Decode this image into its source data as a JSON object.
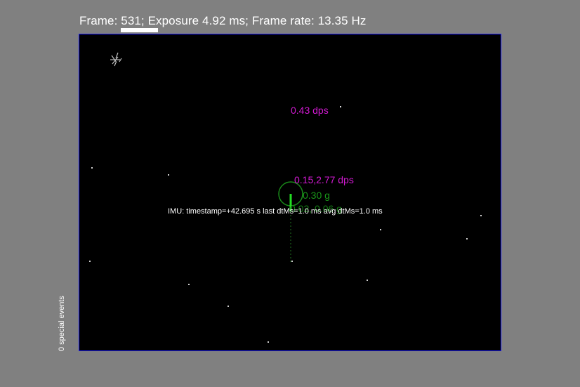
{
  "header": {
    "status_text": "Frame: 531; Exposure 4.92 ms; Frame rate: 13.35 Hz"
  },
  "viewer": {
    "imu_status": "IMU: timestamp=+42.695  s last dtMs=1.0   ms  avg dtMs=1.0   ms",
    "gyro_pan_rate": "0.43 dps",
    "gyro_tilt_roll_rate": "0.15,2.77 dps",
    "accel_magnitude": "0.30 g",
    "accel_xy": "0.02, 0.06 g"
  },
  "side": {
    "special_events": "0 special events"
  },
  "colors": {
    "background": "#808080",
    "viewport": "#000000",
    "border": "#1a1aff",
    "gyro": "#d21ad2",
    "accel": "#199619",
    "accel_vector": "#22dd22"
  }
}
